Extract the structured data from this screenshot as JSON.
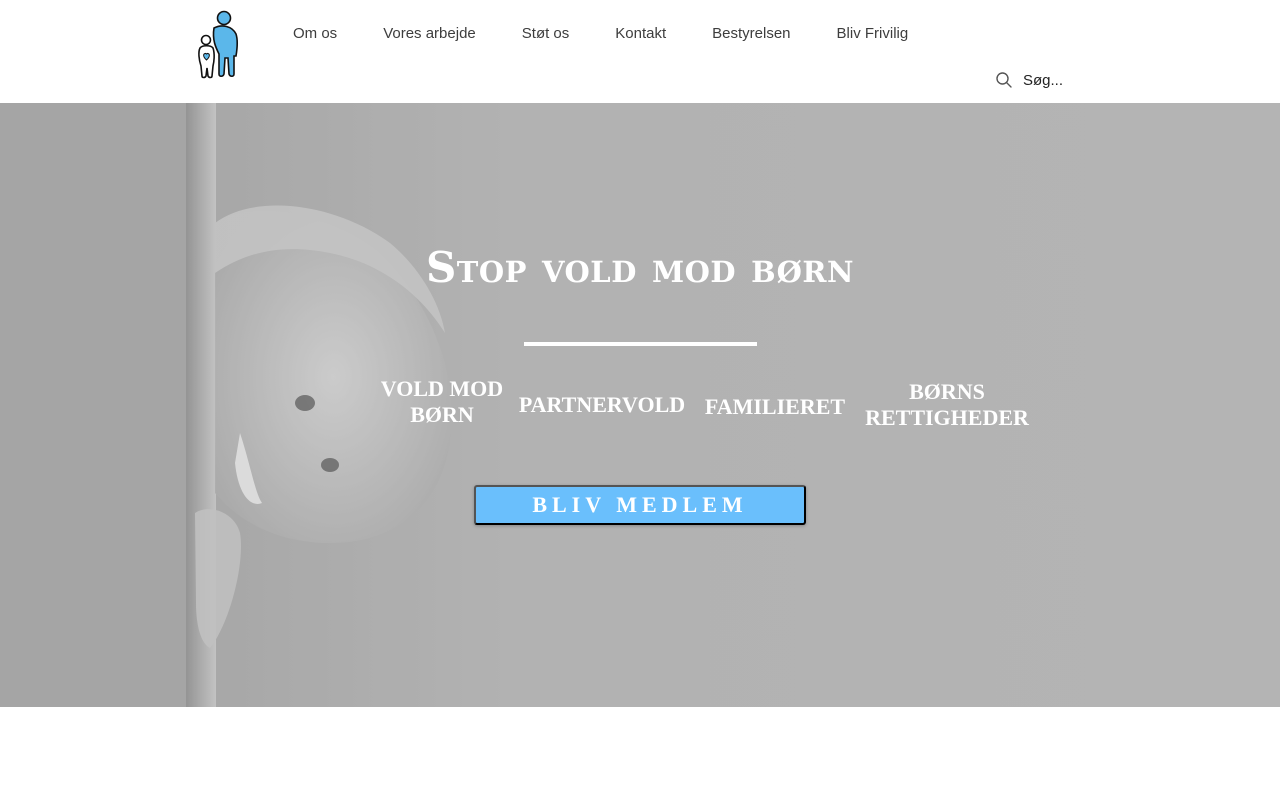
{
  "header": {
    "logo_name": "organization-logo",
    "nav": [
      {
        "label": "Om os"
      },
      {
        "label": "Vores arbejde"
      },
      {
        "label": "Støt os"
      },
      {
        "label": "Kontakt"
      },
      {
        "label": "Bestyrelsen"
      },
      {
        "label": "Bliv Frivilig"
      }
    ],
    "search": {
      "placeholder": "Søg...",
      "icon": "search-icon"
    }
  },
  "hero": {
    "title": "Stop vold mod børn",
    "topics": [
      {
        "label": "VOLD MOD BØRN"
      },
      {
        "label": "PARTNERVOLD"
      },
      {
        "label": "FAMILIERET"
      },
      {
        "label": "BØRNS RETTIGHEDER"
      }
    ],
    "cta_label": "BLIV MEDLEM"
  },
  "colors": {
    "accent": "#6abffc",
    "logo_blue": "#5bb7ea",
    "hero_gray": "#b3b3b3",
    "nav_text": "#3d3d3d"
  }
}
